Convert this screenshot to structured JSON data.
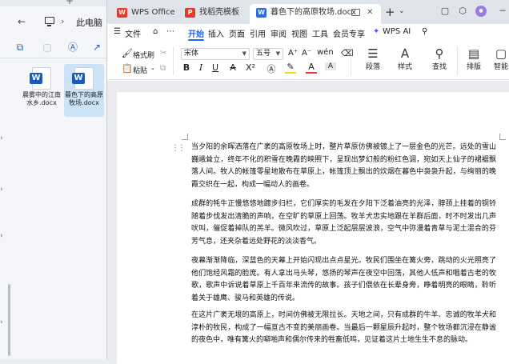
{
  "explorer": {
    "address_label": "此电脑",
    "files": [
      {
        "name": "晨雾中的江南水乡.docx"
      },
      {
        "name": "暮色下的高原牧场.docx"
      }
    ]
  },
  "wps": {
    "tabs": [
      {
        "label": "WPS Office",
        "icon": "wps-logo-icon"
      },
      {
        "label": "找稻壳模板",
        "icon": "pdf-icon"
      },
      {
        "label": "暮色下的高原牧场.docx",
        "icon": "word-doc-icon"
      }
    ],
    "menu": {
      "file": "文件",
      "items": [
        "开始",
        "插入",
        "页面",
        "引用",
        "审阅",
        "视图",
        "工具",
        "会员专享"
      ],
      "active": "开始",
      "wps_ai": "WPS AI"
    },
    "ribbon": {
      "format_painter": "格式刷",
      "paste": "粘贴",
      "font": "宋体",
      "font_size": "五号",
      "paragraph": "段落",
      "styles": "样式",
      "find": "查找",
      "layout": "排版",
      "smart": "智能"
    },
    "document": {
      "paragraphs": [
        "当夕阳的余晖洒落在广袤的高原牧场上时，整片草原仿佛被镀上了一层金色的光芒。远处的雪山巍峨耸立，终年不化的积雪在晚霞的映照下，呈现出梦幻般的粉红色调，宛如天上仙子的裙裾飘落人间。牧人的帐篷零星地散布在草原上，帐篷顶上飘出的炊烟在暮色中袅袅升起，与绚丽的晚霞交织在一起，构成一幅动人的画卷。",
        "成群的牦牛正慢悠悠地踱步归栏，它们厚实的毛发在夕阳下泛着油亮的光泽，脖颈上挂着的铜铃随着步伐发出清脆的声响，在空旷的草原上回荡。牧羊犬忠实地跟在羊群后面，时不时发出几声吠叫，催促着掉队的羔羊。微风吹过，草原上泛起层层波浪，空气中弥漫着青草与泥土混合的芬芳气息，还夹杂着远处野花的淡淡香气。",
        "夜幕渐渐降临，深蓝色的天幕上开始闪现出点点星光。牧民们围坐在篝火旁，跳动的火光照亮了他们饱经风霜的脸庞。有人拿出马头琴，悠扬的琴声在夜空中回荡，其他人低声和唱着古老的牧歌，歌声中诉说着草原上千百年来流传的故事。孩子们偎依在长辈身旁，睁着明亮的眼睛，聆听着关于雄鹰、骏马和英雄的传说。",
        "在这片广袤无垠的高原上，时间仿佛被无限拉长。天地之间，只有成群的牛羊、忠诚的牧羊犬和淳朴的牧民，构成了一幅亘古不变的美丽画卷。当最后一颗星辰升起时，整个牧场都沉浸在静谧的夜色中，唯有篝火的噼啪声和偶尔传来的牲畜低鸣，见证着这片土地生生不息的脉动。"
      ]
    }
  }
}
